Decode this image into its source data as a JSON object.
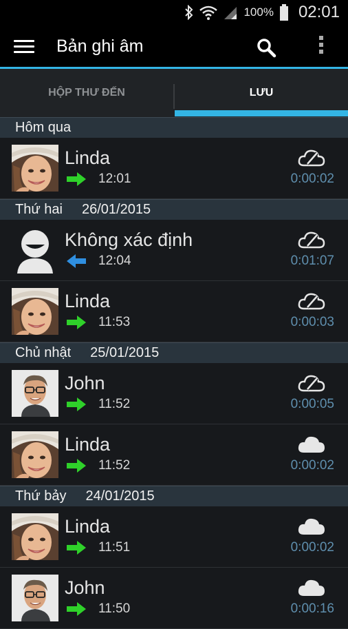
{
  "status": {
    "battery": "100%",
    "time": "02:01"
  },
  "appbar": {
    "title": "Bản ghi âm"
  },
  "tabs": [
    {
      "label": "HỘP THƯ ĐẾN",
      "selected": false
    },
    {
      "label": "LƯU",
      "selected": true
    }
  ],
  "sections": [
    {
      "day": "Hôm qua",
      "date": "",
      "items": [
        {
          "name": "Linda",
          "direction": "outgoing",
          "time": "12:01",
          "duration": "0:00:02",
          "avatar": "linda",
          "cloud": "not-synced"
        }
      ]
    },
    {
      "day": "Thứ hai",
      "date": "26/01/2015",
      "items": [
        {
          "name": "Không xác định",
          "direction": "incoming",
          "time": "12:04",
          "duration": "0:01:07",
          "avatar": "unknown",
          "cloud": "not-synced"
        },
        {
          "name": "Linda",
          "direction": "outgoing",
          "time": "11:53",
          "duration": "0:00:03",
          "avatar": "linda",
          "cloud": "not-synced"
        }
      ]
    },
    {
      "day": "Chủ nhật",
      "date": "25/01/2015",
      "items": [
        {
          "name": "John",
          "direction": "outgoing",
          "time": "11:52",
          "duration": "0:00:05",
          "avatar": "john",
          "cloud": "not-synced"
        },
        {
          "name": "Linda",
          "direction": "outgoing",
          "time": "11:52",
          "duration": "0:00:02",
          "avatar": "linda",
          "cloud": "synced"
        }
      ]
    },
    {
      "day": "Thứ bảy",
      "date": "24/01/2015",
      "items": [
        {
          "name": "Linda",
          "direction": "outgoing",
          "time": "11:51",
          "duration": "0:00:02",
          "avatar": "linda",
          "cloud": "synced"
        },
        {
          "name": "John",
          "direction": "outgoing",
          "time": "11:50",
          "duration": "0:00:16",
          "avatar": "john",
          "cloud": "synced"
        }
      ]
    }
  ],
  "colors": {
    "accent": "#33b5e5",
    "outgoing": "#2fd12a",
    "incoming": "#2f8fe0",
    "duration": "#5f8fae",
    "section_bg": "#29343d"
  }
}
